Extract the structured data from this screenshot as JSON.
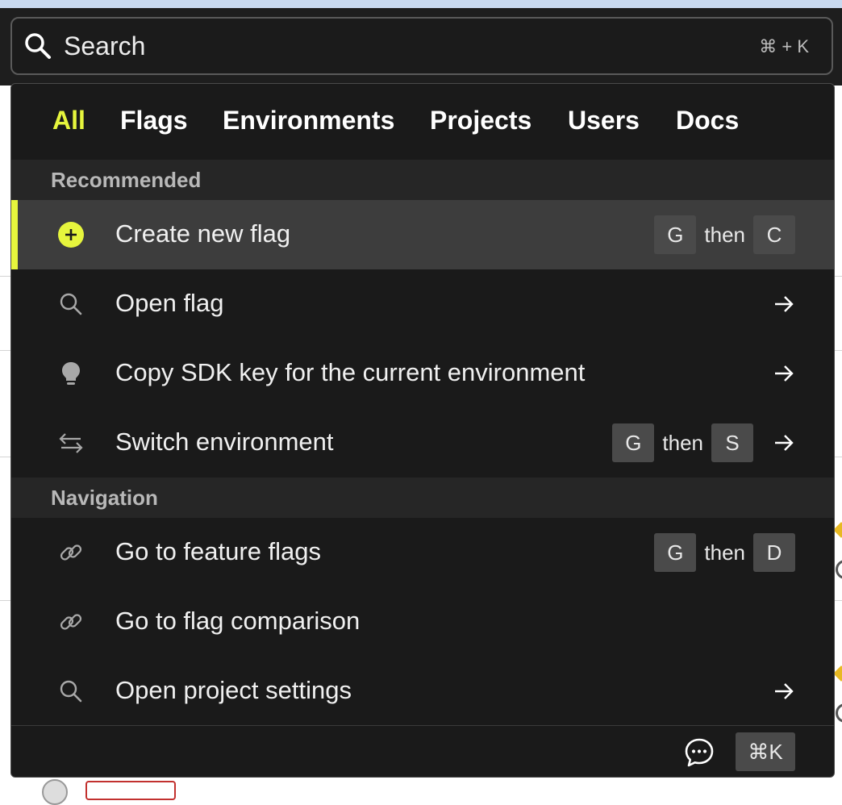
{
  "search": {
    "placeholder": "Search",
    "shortcut_hint": "⌘ + K"
  },
  "tabs": [
    {
      "label": "All",
      "active": true
    },
    {
      "label": "Flags",
      "active": false
    },
    {
      "label": "Environments",
      "active": false
    },
    {
      "label": "Projects",
      "active": false
    },
    {
      "label": "Users",
      "active": false
    },
    {
      "label": "Docs",
      "active": false
    }
  ],
  "sections": {
    "recommended": {
      "title": "Recommended",
      "items": [
        {
          "label": "Create new flag",
          "icon": "plus-circle-icon",
          "selected": true,
          "shortcut": {
            "key1": "G",
            "then": "then",
            "key2": "C"
          }
        },
        {
          "label": "Open flag",
          "icon": "search-icon",
          "arrow": true
        },
        {
          "label": "Copy SDK key for the current environment",
          "icon": "lightbulb-icon",
          "arrow": true
        },
        {
          "label": "Switch environment",
          "icon": "switch-arrows-icon",
          "arrow": true,
          "shortcut": {
            "key1": "G",
            "then": "then",
            "key2": "S"
          }
        }
      ]
    },
    "navigation": {
      "title": "Navigation",
      "items": [
        {
          "label": "Go to feature flags",
          "icon": "link-icon",
          "shortcut": {
            "key1": "G",
            "then": "then",
            "key2": "D"
          }
        },
        {
          "label": "Go to flag comparison",
          "icon": "link-icon"
        },
        {
          "label": "Open project settings",
          "icon": "search-icon",
          "arrow": true
        }
      ]
    }
  },
  "footer": {
    "chat_icon": "chat-bubble-icon",
    "key_hint": "⌘K"
  },
  "colors": {
    "accent": "#e6f53d",
    "panel_bg": "#1a1a1a",
    "selected_row_bg": "#3d3d3d",
    "key_bg": "#4a4a4a"
  }
}
